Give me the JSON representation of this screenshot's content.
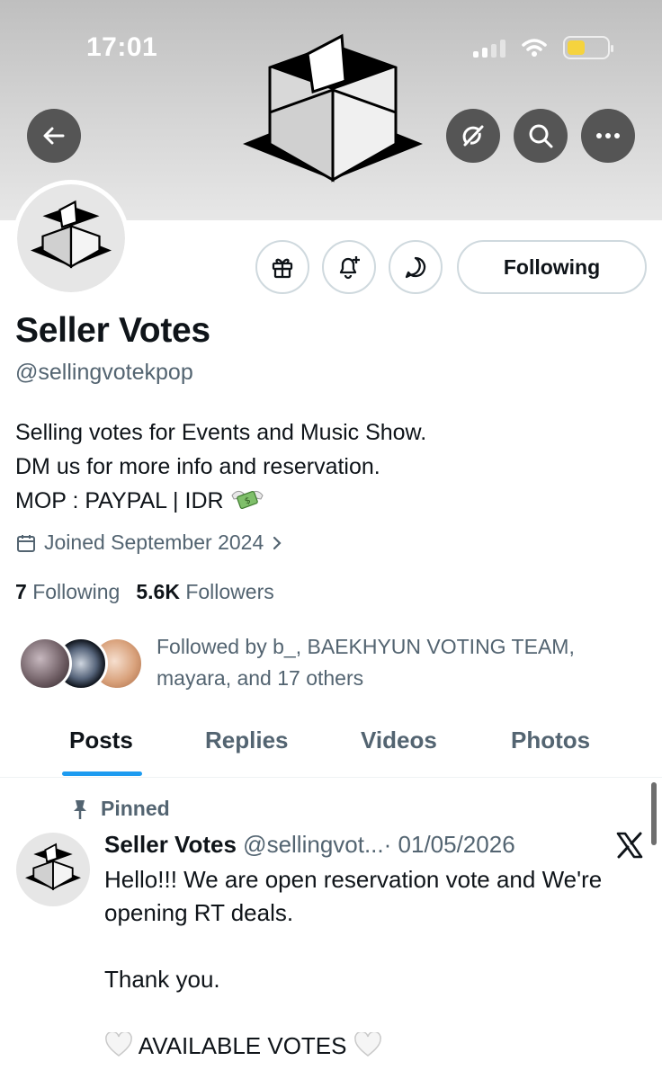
{
  "status_bar": {
    "time": "17:01"
  },
  "colors": {
    "accent": "#1d9bf0",
    "battery": "#f5d33e",
    "muted_text": "#536471"
  },
  "nav_icons": [
    "back-arrow-icon",
    "grok-icon",
    "search-icon",
    "more-icon"
  ],
  "profile": {
    "display_name": "Seller Votes",
    "handle": "@sellingvotekpop",
    "bio": [
      "Selling votes for Events and Music Show.",
      "DM us for more info and reservation.",
      "MOP : PAYPAL | IDR"
    ],
    "bio_emoji": "money-with-wings-icon",
    "joined": "Joined September 2024",
    "following_count": "7",
    "following_label": "Following",
    "followers_count": "5.6K",
    "followers_label": "Followers",
    "followed_by_line1": "Followed by b_, BAEKHYUN VOTING TEAM,",
    "followed_by_line2": "mayara, and 17 others"
  },
  "actions": {
    "icons": [
      "gift-icon",
      "bell-plus-icon",
      "message-bubble-icon"
    ],
    "following_button": "Following"
  },
  "tabs": [
    {
      "label": "Posts",
      "active": true
    },
    {
      "label": "Replies",
      "active": false
    },
    {
      "label": "Videos",
      "active": false
    },
    {
      "label": "Photos",
      "active": false
    }
  ],
  "pinned_post": {
    "pinned_label": "Pinned",
    "author_name": "Seller Votes",
    "author_handle": "@sellingvot...",
    "date": "· 01/05/2026",
    "paragraphs": [
      "Hello!!! We are open reservation vote and We're opening RT deals.",
      "Thank you."
    ],
    "available_votes": "AVAILABLE VOTES"
  }
}
